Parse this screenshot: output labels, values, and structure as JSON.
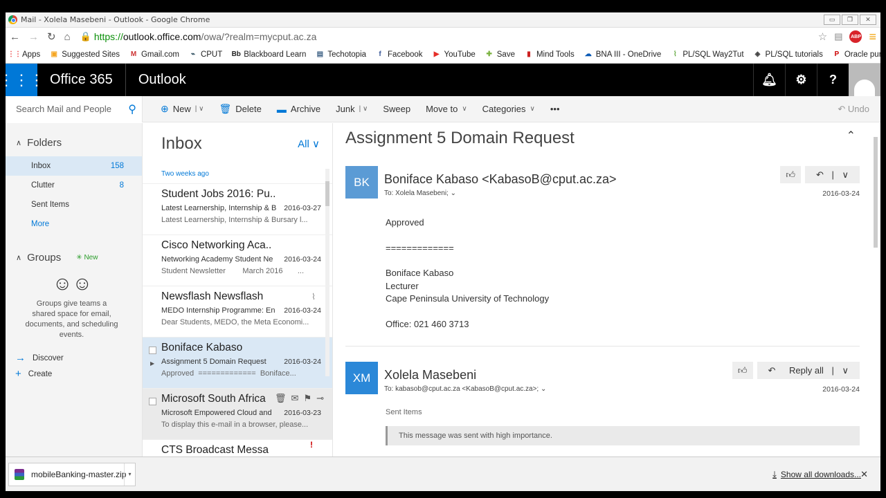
{
  "browser": {
    "window_title": "Mail - Xolela Masebeni - Outlook - Google Chrome",
    "url_scheme": "https://",
    "url_host": "outlook.office.com",
    "url_rest": "/owa/?realm=mycput.ac.za",
    "abp_label": "ABP",
    "bookmarks": [
      {
        "label": "Apps",
        "icon": "apps-grid-icon",
        "color": "#e44"
      },
      {
        "label": "Suggested Sites",
        "icon": "suggested-sites-icon",
        "color": "#f5a623"
      },
      {
        "label": "Gmail.com",
        "icon": "gmail-icon",
        "color": "#c33"
      },
      {
        "label": "CPUT",
        "icon": "cput-icon",
        "color": "#245"
      },
      {
        "label": "Blackboard Learn",
        "icon": "blackboard-icon",
        "color": "#222"
      },
      {
        "label": "Techotopia",
        "icon": "page-icon",
        "color": "#468"
      },
      {
        "label": "Facebook",
        "icon": "facebook-icon",
        "color": "#3b5998"
      },
      {
        "label": "YouTube",
        "icon": "youtube-icon",
        "color": "#e52d27"
      },
      {
        "label": "Save",
        "icon": "save-icon",
        "color": "#7cb342"
      },
      {
        "label": "Mind Tools",
        "icon": "mindtools-icon",
        "color": "#c22"
      },
      {
        "label": "BNA III - OneDrive",
        "icon": "onedrive-icon",
        "color": "#0a5ab5"
      },
      {
        "label": "PL/SQL Way2Tut",
        "icon": "way2tut-icon",
        "color": "#6a4"
      },
      {
        "label": "PL/SQL tutorials",
        "icon": "tutorials-icon",
        "color": "#444"
      },
      {
        "label": "Oracle pure",
        "icon": "oracle-icon",
        "color": "#c00"
      }
    ],
    "more_bookmarks": "»"
  },
  "header": {
    "app_suite": "Office 365",
    "app_name": "Outlook"
  },
  "commands": {
    "search_placeholder": "Search Mail and People",
    "new": "New",
    "delete": "Delete",
    "archive": "Archive",
    "junk": "Junk",
    "sweep": "Sweep",
    "move_to": "Move to",
    "categories": "Categories",
    "more": "•••",
    "undo": "Undo"
  },
  "nav": {
    "folders_heading": "Folders",
    "folders": [
      {
        "label": "Inbox",
        "count": "158"
      },
      {
        "label": "Clutter",
        "count": "8"
      },
      {
        "label": "Sent Items",
        "count": ""
      },
      {
        "label": "More",
        "count": ""
      }
    ],
    "groups_heading": "Groups",
    "groups_new": "New",
    "groups_desc": "Groups give teams a shared space for email, documents, and scheduling events.",
    "discover": "Discover",
    "create": "Create"
  },
  "list": {
    "title": "Inbox",
    "filter": "All",
    "group_label": "Two weeks ago",
    "messages": [
      {
        "from": "Student Jobs 2016: Pu..",
        "subject": "Latest Learnership, Internship & B",
        "date": "2016-03-27",
        "preview": "Latest Learnership, Internship & Bursary l..."
      },
      {
        "from": "Cisco Networking Aca..",
        "subject": "Networking Academy Student Ne",
        "date": "2016-03-24",
        "preview": "Student Newsletter        March 2016       ..."
      },
      {
        "from": "Newsflash Newsflash",
        "subject": "MEDO Internship Programme: En",
        "date": "2016-03-24",
        "preview": "Dear Students, MEDO, the Meta Economi..."
      },
      {
        "from": "Boniface Kabaso",
        "subject": "Assignment 5 Domain Request",
        "date": "2016-03-24",
        "preview": "Approved  =============  Boniface..."
      },
      {
        "from": "Microsoft South Africa",
        "subject": "Microsoft Empowered Cloud and",
        "date": "2016-03-23",
        "preview": "To display this e-mail in a browser, please..."
      },
      {
        "from": "CTS Broadcast Messa",
        "subject": "",
        "date": "",
        "preview": ""
      }
    ]
  },
  "reading": {
    "title": "Assignment 5 Domain Request",
    "mail1": {
      "initials": "BK",
      "initials_color": "#5b9bd5",
      "sender": "Boniface Kabaso <KabasoB@cput.ac.za>",
      "to": "To: Xolela Masebeni;",
      "date": "2016-03-24",
      "body": [
        "Approved",
        "",
        "=============",
        "",
        "Boniface Kabaso",
        "Lecturer",
        "Cape Peninsula University of Technology",
        "",
        "Office: 021 460 3713"
      ]
    },
    "mail2": {
      "initials": "XM",
      "initials_color": "#2b88d8",
      "sender": "Xolela Masebeni",
      "to": "To: kabasob@cput.ac.za <KabasoB@cput.ac.za>;",
      "date": "2016-03-24",
      "reply_all": "Reply all",
      "folder": "Sent Items",
      "importance": "This message was sent with high importance."
    }
  },
  "downloads": {
    "file": "mobileBanking-master.zip",
    "show_all": "Show all downloads..."
  }
}
